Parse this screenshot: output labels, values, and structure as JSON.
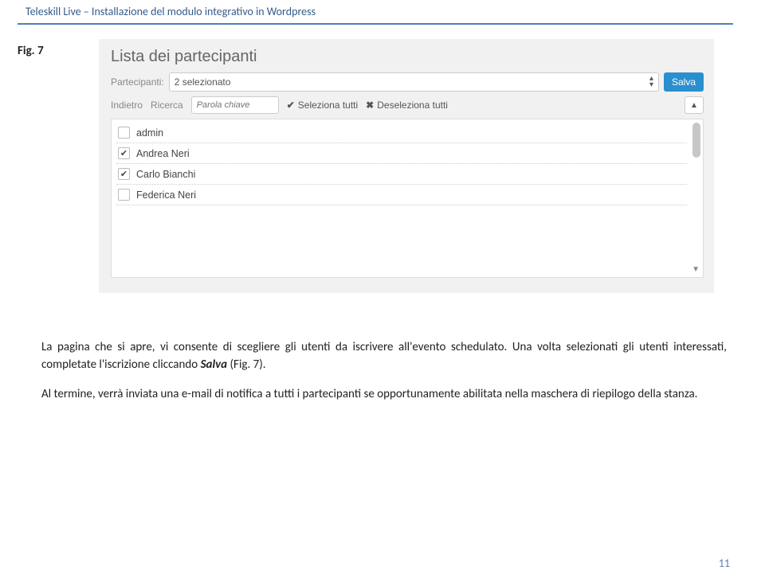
{
  "doc": {
    "header": "Teleskill Live – Installazione del modulo integrativo in Wordpress",
    "figure_label": "Fig. 7",
    "page_number": "11"
  },
  "screenshot": {
    "title": "Lista dei partecipanti",
    "participants_label": "Partecipanti:",
    "selected_text": "2 selezionato",
    "save_button": "Salva",
    "back_link": "Indietro",
    "search_label": "Ricerca",
    "search_placeholder": "Parola chiave",
    "select_all": "Seleziona tutti",
    "deselect_all": "Deseleziona tutti",
    "users": [
      {
        "name": "admin",
        "checked": false
      },
      {
        "name": "Andrea Neri",
        "checked": true
      },
      {
        "name": "Carlo Bianchi",
        "checked": true
      },
      {
        "name": "Federica Neri",
        "checked": false
      }
    ]
  },
  "body": {
    "p1a": "La pagina che si apre, vi consente di scegliere gli utenti da iscrivere all'evento schedulato. Una volta selezionati gli utenti interessati, completate l'iscrizione cliccando ",
    "p1b": "Salva",
    "p1c": " (Fig. 7).",
    "p2": "Al termine, verrà inviata una e-mail di notifica a tutti i partecipanti se opportunamente abilitata nella maschera di riepilogo della stanza."
  }
}
